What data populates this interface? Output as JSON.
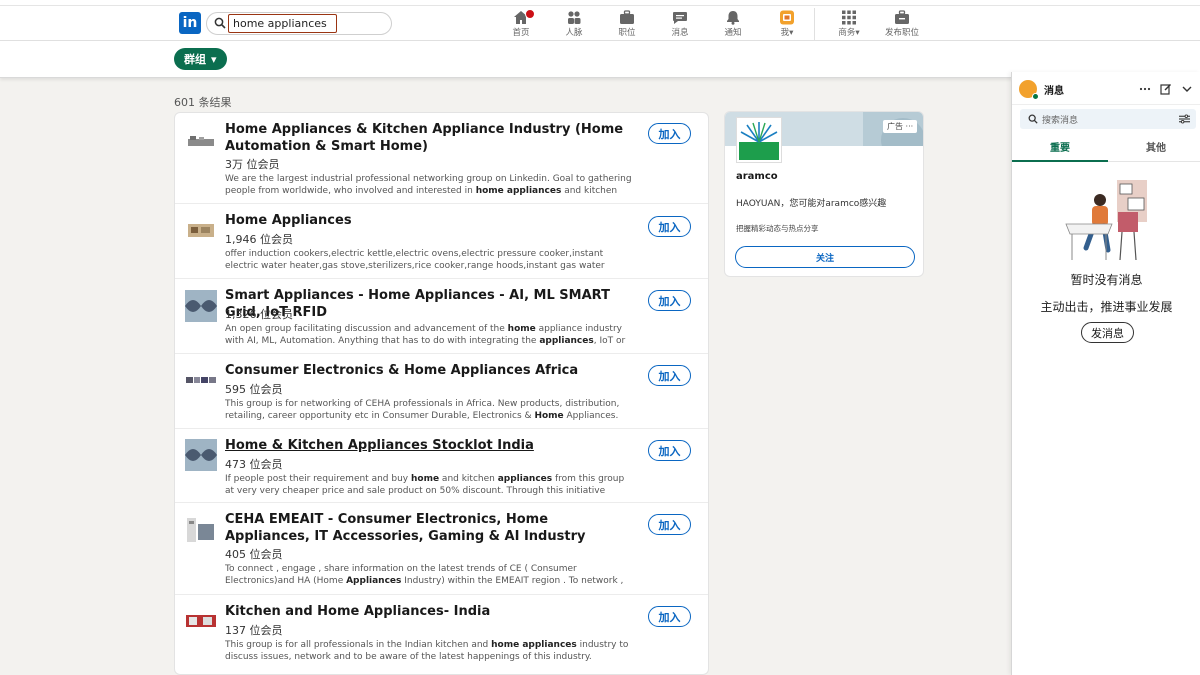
{
  "search": {
    "value": "home appliances"
  },
  "nav": [
    {
      "label": "首页",
      "icon": "home-icon"
    },
    {
      "label": "人脉",
      "icon": "network-icon"
    },
    {
      "label": "职位",
      "icon": "jobs-icon"
    },
    {
      "label": "消息",
      "icon": "messaging-icon"
    },
    {
      "label": "通知",
      "icon": "bell-icon"
    },
    {
      "label": "我",
      "icon": "me-avatar-icon"
    },
    {
      "label": "商务",
      "icon": "grid-icon"
    },
    {
      "label": "发布职位",
      "icon": "post-job-icon"
    }
  ],
  "filter": {
    "label": "群组"
  },
  "results_count": "601 条结果",
  "join_label": "加入",
  "groups": [
    {
      "title": "Home Appliances & Kitchen Appliance Industry (Home Automation & Smart Home)",
      "members": "3万 位会员",
      "desc": [
        "We are the largest industrial professional networking group on Linkedin. Goal to gathering people from worldwide, who involved and interested in ",
        "home appliances",
        " and kitchen appliance industr..."
      ]
    },
    {
      "title": "Home Appliances",
      "members": "1,946 位会员",
      "desc": [
        "offer induction cookers,electric kettle,electric ovens,electric pressure cooker,instant electric water heater,gas stove,sterilizers,rice cooker,range hoods,instant gas water heater,electric storage water..."
      ]
    },
    {
      "title": "Smart Appliances - Home Appliances - AI, ML SMART Grid, IoT RFID",
      "members": "1,326 位会员",
      "desc": [
        "An open group facilitating discussion and advancement of the ",
        "home",
        " appliance industry with AI, ML, Automation. Anything that has to do with integrating the ",
        "appliances",
        ", IoT or next gen device..."
      ]
    },
    {
      "title": "Consumer Electronics & Home Appliances Africa",
      "members": "595 位会员",
      "desc": [
        "This group is for networking of CEHA professionals in Africa. New products, distribution, retailing, career opportunity etc in Consumer Durable, Electronics & ",
        "Home",
        " Appliances."
      ]
    },
    {
      "title": "Home & Kitchen Appliances Stocklot India",
      "members": "473 位会员",
      "desc": [
        "If people post their requirement and buy ",
        "home",
        " and kitchen ",
        "appliances",
        " from this group at very very cheaper price and sale product on 50% discount. Through this initiative general public can g..."
      ]
    },
    {
      "title": "CEHA EMEAIT - Consumer Electronics, Home Appliances, IT Accessories, Gaming & AI Industry",
      "members": "405 位会员",
      "desc": [
        "To connect , engage , share information on the latest trends of CE ( Consumer Electronics)and HA (Home ",
        "Appliances",
        " Industry) within the EMEAIT region . To network , support each other grow. To..."
      ]
    },
    {
      "title": "Kitchen and Home Appliances- India",
      "members": "137 位会员",
      "desc": [
        "This group is for all professionals in the Indian kitchen and ",
        "home appliances",
        " industry to discuss issues, network and to be aware of the latest happenings of this industry."
      ]
    }
  ],
  "ad": {
    "tag": "广告",
    "name": "aramco",
    "line": "HAOYUAN，您可能对aramco感兴趣",
    "small": "把握精彩动态与热点分享",
    "follow": "关注"
  },
  "messaging": {
    "title": "消息",
    "search_placeholder": "搜索消息",
    "tabs": [
      "重要",
      "其他"
    ],
    "empty_title": "暂时没有消息",
    "empty_sub": "主动出击，推进事业发展",
    "send_label": "发消息"
  },
  "colors": {
    "brand": "#0a66c2",
    "accent": "#0b6e4f",
    "badge": "#cc1016"
  }
}
